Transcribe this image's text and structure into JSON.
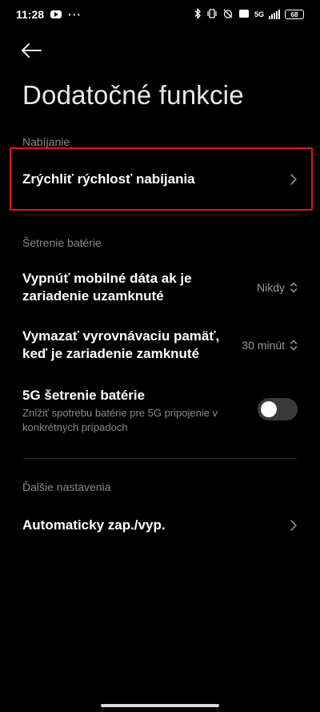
{
  "status_bar": {
    "time": "11:28",
    "dots": "···",
    "network": "5G",
    "battery": "68"
  },
  "header": {
    "title": "Dodatočné funkcie"
  },
  "sections": {
    "charging": {
      "header": "Nabíjanie",
      "fast_charge_label": "Zrýchliť rýchlosť nabíjania"
    },
    "battery_saving": {
      "header": "Šetrenie batérie",
      "mobile_data": {
        "label_line1": "Vypnúť mobilné dáta ak je",
        "label_line2": "zariadenie uzamknuté",
        "value": "Nikdy"
      },
      "cache": {
        "label_line1": "Vymazať vyrovnávaciu pamäť,",
        "label_line2": "keď je zariadenie zamknuté",
        "value": "30 minút"
      },
      "fiveg": {
        "label": "5G šetrenie batérie",
        "sub_line1": "Znížiť spotrebu batérie pre 5G pripojenie v",
        "sub_line2": "konkrétnych prípadoch",
        "enabled": false
      }
    },
    "other": {
      "header": "Ďalšie nastavenia",
      "auto_label": "Automaticky zap./vyp."
    }
  },
  "colors": {
    "background": "#000000",
    "highlight": "#e0161e",
    "muted": "#8a8a8a"
  }
}
